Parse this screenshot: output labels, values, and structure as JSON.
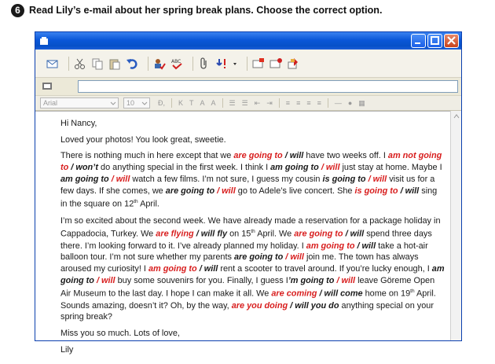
{
  "instruction": {
    "number": "6",
    "text": "Read Lily’s e-mail about her spring break plans. Choose the correct option."
  },
  "window": {
    "accent": "#0a57d8",
    "close_color": "#c9421c"
  },
  "format_bar": {
    "font": "Arial",
    "size": "10",
    "buttons": [
      "K",
      "T",
      "A",
      "A"
    ]
  },
  "email": {
    "greeting": "Hi Nancy,",
    "line1": "Loved your photos! You look great, sweetie.",
    "p1": {
      "t1": "There is nothing much in here except that we ",
      "o1": "are going to",
      "s1": " / will",
      "t2": " have two weeks off. I ",
      "o2": "am not going to",
      "s2": " / won’t",
      "t3": " do anything special in the first week. I think I ",
      "o3a": "am going to",
      "o3b": " / will",
      "t4": " just stay at home. Maybe I ",
      "o4a": "am going to",
      "o4b": " / will",
      "t5": " watch a few films. I’m not sure, I guess my cousin ",
      "o5a": "is going to",
      "o5b": " / will",
      "t6": " visit us for a few days. If she comes, we ",
      "o6a": "are going to",
      "o6b": " / will",
      "t7": " go to Adele’s live concert. She ",
      "o7": "is going to",
      "s7": " / will",
      "t8": " sing in the square on 12",
      "sup8": "th",
      "t9": " April."
    },
    "p2": {
      "t1": "I’m so excited about the second week. We have already made a reservation for a package holiday in Cappadocia, Turkey. We ",
      "o1": "are flying",
      "s1": " / will fly",
      "t2": " on 15",
      "sup2": "th",
      "t3": " April. We ",
      "o3a": "are going to",
      "o3b": " / will",
      "t4": " spend three days there. I’m looking forward to it. I’ve already planned my holiday. I ",
      "o4a": "am going to",
      "o4b": " / will",
      "t5": " take a hot-air balloon tour. I’m not sure whether my parents ",
      "o5a": "are going to",
      "o5b": " / will",
      "t6": " join me. The town has always aroused my curiosity! I ",
      "o6a": "am going to",
      "o6b": " / will",
      "t7": " rent a scooter to travel around. If you’re lucky enough, I ",
      "o7a": "am going to",
      "o7b": " / will",
      "t8": " buy some souvenirs for you. Finally, I guess I",
      "o8a": "’m going to",
      "o8b": " / will",
      "t9": " leave Göreme Open Air Museum to the last day. I hope I can make it all. We ",
      "o9": "are coming",
      "s9": " / will come",
      "t10": " home on 19",
      "sup10": "th",
      "t11": " April. Sounds amazing, doesn’t it? Oh, by the way, ",
      "o11": "are you doing",
      "s11": " / will you do",
      "t12": " anything special on your spring break?"
    },
    "closing": "Miss you so much. Lots of love,",
    "signature": "Lily"
  }
}
